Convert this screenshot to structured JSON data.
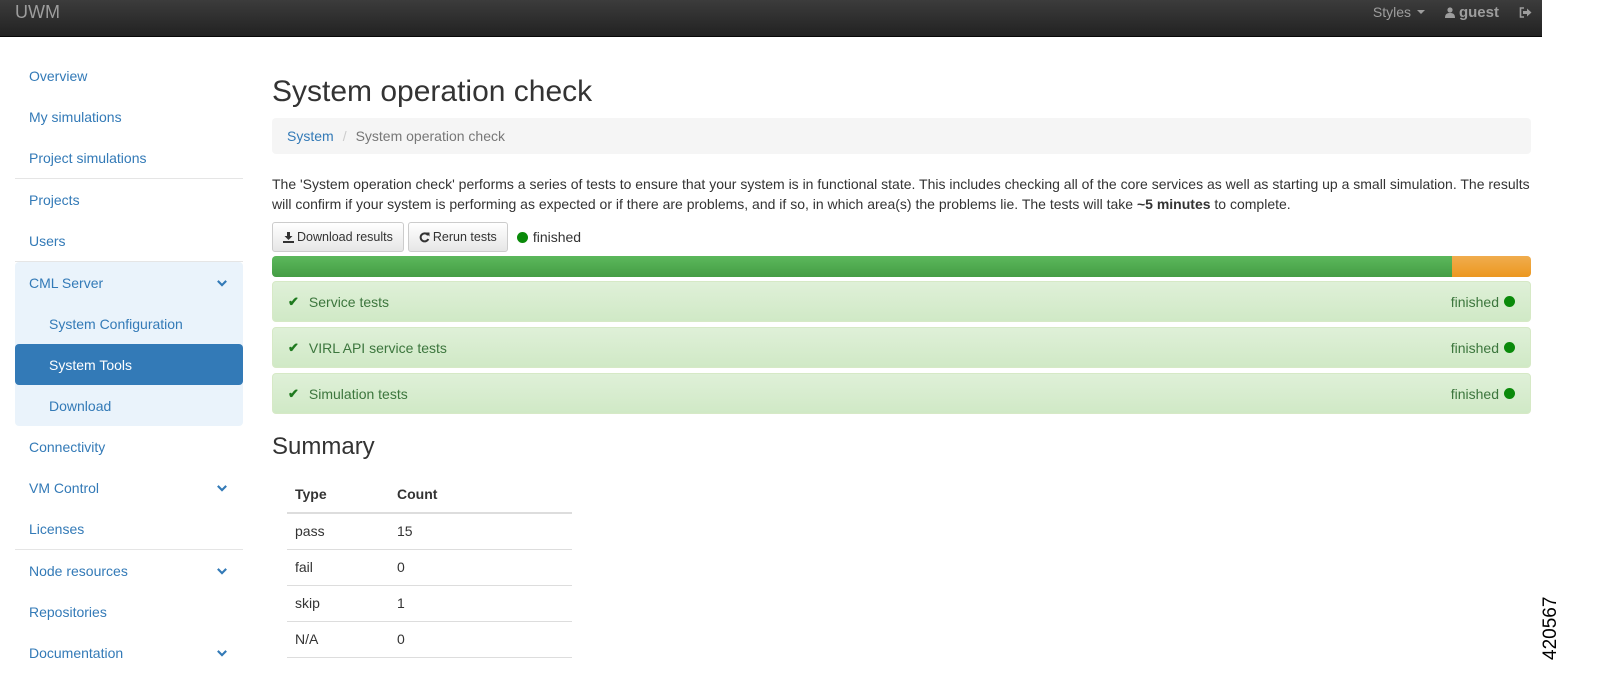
{
  "navbar": {
    "brand": "UWM",
    "styles_label": "Styles",
    "user_label": "guest",
    "icons": {
      "user": "user-icon",
      "logout": "sign-out-icon",
      "styles_caret": "caret-down-icon"
    }
  },
  "sidebar": {
    "items": [
      {
        "label": "Overview"
      },
      {
        "label": "My simulations"
      },
      {
        "label": "Project simulations"
      },
      {
        "label": "Projects"
      },
      {
        "label": "Users"
      },
      {
        "label": "CML Server",
        "expandable": true,
        "expanded": true,
        "children": [
          {
            "label": "System Configuration"
          },
          {
            "label": "System Tools",
            "active": true
          },
          {
            "label": "Download"
          }
        ]
      },
      {
        "label": "Connectivity"
      },
      {
        "label": "VM Control",
        "expandable": true
      },
      {
        "label": "Licenses"
      },
      {
        "label": "Node resources",
        "expandable": true
      },
      {
        "label": "Repositories"
      },
      {
        "label": "Documentation",
        "expandable": true
      }
    ]
  },
  "main": {
    "title": "System operation check",
    "breadcrumb": {
      "parent": "System",
      "separator": "/",
      "current": "System operation check"
    },
    "description": {
      "before": "The 'System operation check' performs a series of tests to ensure that your system is in functional state. This includes checking all of the core services as well as starting up a small simulation. The results will confirm if your system is performing as expected or if there are problems, and if so, in which area(s) the problems lie. The tests will take ",
      "bold": "~5 minutes",
      "after": " to complete."
    },
    "actions": {
      "download_label": "Download results",
      "rerun_label": "Rerun tests",
      "status_text": "finished",
      "status_color": "#0a8a0a"
    },
    "progress": {
      "pass_fraction": 0.9375,
      "skip_fraction": 0.0625,
      "pass_color": "#5cb85c",
      "skip_color": "#f0ad4e"
    },
    "test_groups": [
      {
        "label": "Service tests",
        "status": "finished"
      },
      {
        "label": "VIRL API service tests",
        "status": "finished"
      },
      {
        "label": "Simulation tests",
        "status": "finished"
      }
    ],
    "summary": {
      "title": "Summary",
      "columns": [
        "Type",
        "Count"
      ],
      "rows": [
        {
          "type": "pass",
          "count": "15"
        },
        {
          "type": "fail",
          "count": "0"
        },
        {
          "type": "skip",
          "count": "1"
        },
        {
          "type": "N/A",
          "count": "0"
        }
      ]
    }
  },
  "figure_id": "420567"
}
